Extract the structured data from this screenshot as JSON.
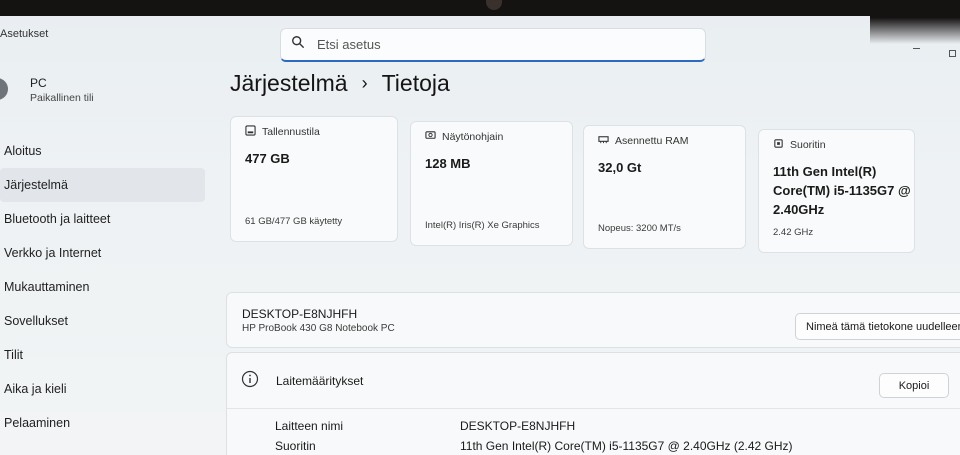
{
  "window": {
    "title": "Asetukset"
  },
  "search": {
    "placeholder": "Etsi asetus"
  },
  "user": {
    "name": "PC",
    "account_type": "Paikallinen tili"
  },
  "sidebar": {
    "items": [
      {
        "label": "Aloitus",
        "active": false
      },
      {
        "label": "Järjestelmä",
        "active": true
      },
      {
        "label": "Bluetooth ja laitteet",
        "active": false
      },
      {
        "label": "Verkko ja Internet",
        "active": false
      },
      {
        "label": "Mukauttaminen",
        "active": false
      },
      {
        "label": "Sovellukset",
        "active": false
      },
      {
        "label": "Tilit",
        "active": false
      },
      {
        "label": "Aika ja kieli",
        "active": false
      },
      {
        "label": "Pelaaminen",
        "active": false
      }
    ]
  },
  "breadcrumb": {
    "parent": "Järjestelmä",
    "separator": "›",
    "current": "Tietoja"
  },
  "cards": {
    "storage": {
      "title": "Tallennustila",
      "value": "477 GB",
      "footer": "61 GB/477 GB käytetty"
    },
    "gpu": {
      "title": "Näytönohjain",
      "value": "128 MB",
      "footer": "Intel(R) Iris(R) Xe Graphics"
    },
    "ram": {
      "title": "Asennettu RAM",
      "value": "32,0 Gt",
      "footer": "Nopeus: 3200 MT/s"
    },
    "cpu": {
      "title": "Suoritin",
      "value": "11th Gen Intel(R) Core(TM) i5-1135G7 @ 2.40GHz",
      "footer": "2.42 GHz"
    }
  },
  "device": {
    "name": "DESKTOP-E8NJHFH",
    "model": "HP ProBook 430 G8 Notebook PC",
    "rename_label": "Nimeä tämä tietokone uudelleen"
  },
  "specs": {
    "title": "Laitemääritykset",
    "copy_label": "Kopioi",
    "rows": [
      {
        "key": "Laitteen nimi",
        "value": "DESKTOP-E8NJHFH"
      },
      {
        "key": "Suoritin",
        "value": "11th Gen Intel(R) Core(TM) i5-1135G7 @ 2.40GHz (2.42 GHz)"
      }
    ]
  },
  "colors": {
    "accent": "#2d6ac0",
    "sidebar_active": "#e2e6ea"
  }
}
